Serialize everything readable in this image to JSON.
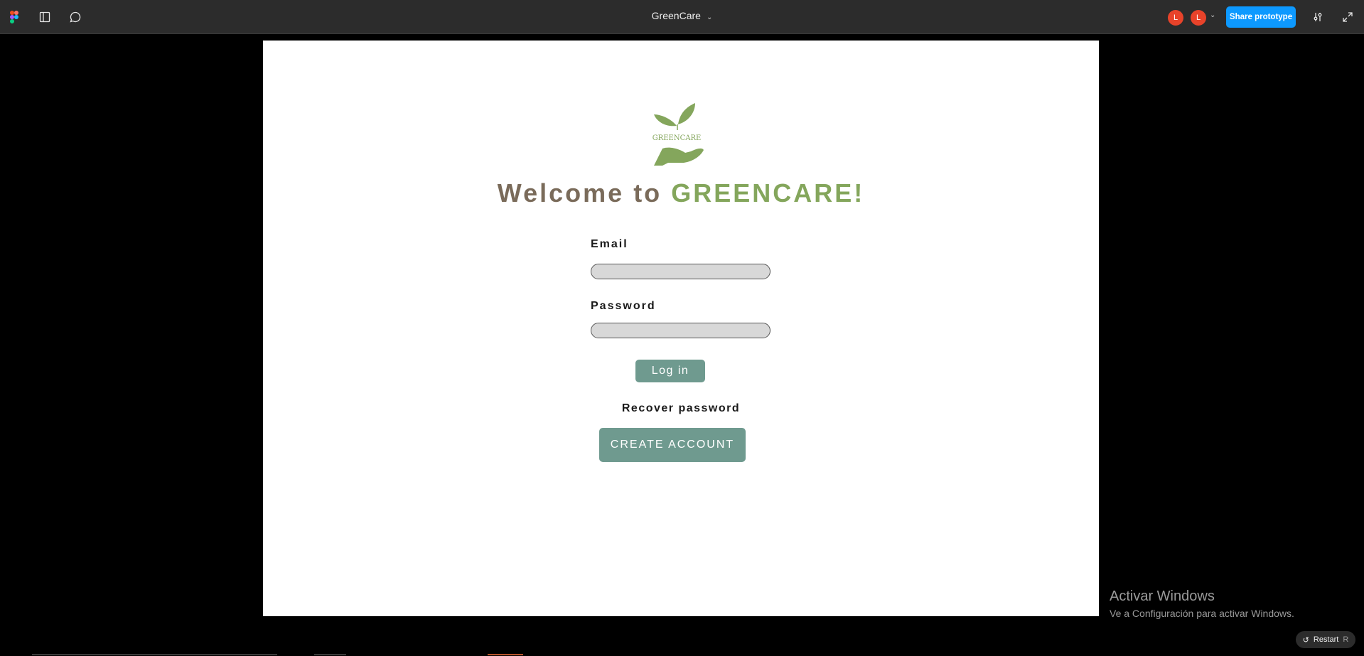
{
  "app": {
    "doc_title": "GreenCare",
    "share_label": "Share prototype",
    "avatars": [
      "L",
      "L"
    ],
    "icons": [
      "figma-logo-icon",
      "sidebar-toggle-icon",
      "comment-icon",
      "chevron-down-icon",
      "settings-sliders-icon",
      "expand-icon"
    ]
  },
  "screen": {
    "logo_text": "GREENCARE",
    "welcome_prefix": "Welcome to ",
    "welcome_brand": "GREENCARE!",
    "email_label": "Email",
    "email_value": "",
    "password_label": "Password",
    "password_value": "",
    "login_label": "Log in",
    "recover_label": "Recover password",
    "create_label": "CREATE ACCOUNT"
  },
  "colors": {
    "brand_green": "#84a65c",
    "brown": "#7a6b5a",
    "button_teal": "#6f9a8f",
    "accent_blue": "#0d99ff"
  },
  "overlay": {
    "activate_title": "Activar Windows",
    "activate_sub": "Ve a Configuración para activar Windows.",
    "restart_label": "Restart",
    "restart_key": "R"
  }
}
